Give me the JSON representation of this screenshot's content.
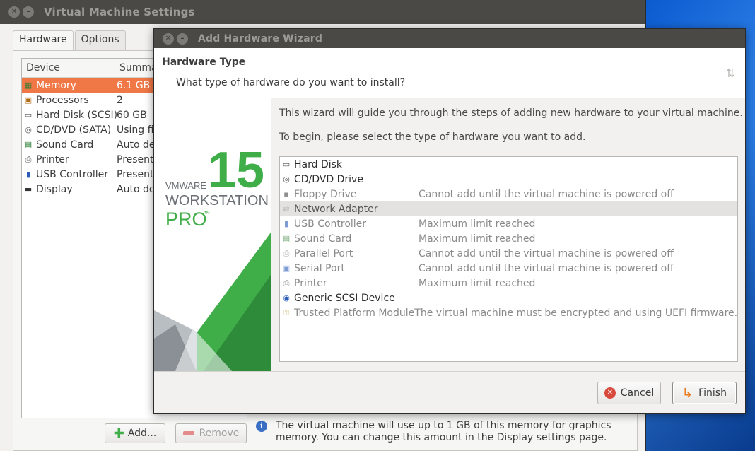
{
  "main_window": {
    "title": "Virtual Machine Settings",
    "tabs": [
      {
        "label": "Hardware",
        "active": true
      },
      {
        "label": "Options",
        "active": false
      }
    ],
    "device_table": {
      "columns": [
        "Device",
        "Summary"
      ],
      "column_visible": [
        "Device",
        "Summa"
      ],
      "rows": [
        {
          "icon": "memory-icon",
          "device": "Memory",
          "summary": "6.1 GB",
          "selected": true
        },
        {
          "icon": "cpu-icon",
          "device": "Processors",
          "summary": "2"
        },
        {
          "icon": "harddisk-icon",
          "device": "Hard Disk (SCSI)",
          "summary": "60 GB"
        },
        {
          "icon": "cd-icon",
          "device": "CD/DVD (SATA)",
          "summary": "Using fi"
        },
        {
          "icon": "soundcard-icon",
          "device": "Sound Card",
          "summary": "Auto de"
        },
        {
          "icon": "printer-icon",
          "device": "Printer",
          "summary": "Present"
        },
        {
          "icon": "usb-icon",
          "device": "USB Controller",
          "summary": "Present"
        },
        {
          "icon": "display-icon",
          "device": "Display",
          "summary": "Auto de"
        }
      ]
    },
    "add_button": "Add...",
    "remove_button": "Remove",
    "info_text_line1": "The virtual machine will use up to 1 GB of this memory for graphics",
    "info_text_line2": "memory. You can change this amount in the Display settings page."
  },
  "wizard": {
    "title": "Add Hardware Wizard",
    "header_title": "Hardware Type",
    "header_subtitle": "What type of hardware do you want to install?",
    "intro_line1": "This wizard will guide you through the steps of adding new hardware to your virtual machine.",
    "intro_line2": "To begin, please select the type of hardware you want to add.",
    "banner": {
      "brand": "VMWARE",
      "version": "15",
      "product": "WORKSTATION",
      "edition": "PRO",
      "tm": "™"
    },
    "hardware_list": [
      {
        "icon": "harddisk-icon",
        "name": "Hard Disk",
        "note": "",
        "state": "enabled"
      },
      {
        "icon": "cd-icon",
        "name": "CD/DVD Drive",
        "note": "",
        "state": "enabled"
      },
      {
        "icon": "floppy-icon",
        "name": "Floppy Drive",
        "note": "Cannot add until the virtual machine is powered off",
        "state": "disabled"
      },
      {
        "icon": "network-icon",
        "name": "Network Adapter",
        "note": "",
        "state": "selected"
      },
      {
        "icon": "usb-icon",
        "name": "USB Controller",
        "note": "Maximum limit reached",
        "state": "disabled"
      },
      {
        "icon": "soundcard-icon",
        "name": "Sound Card",
        "note": "Maximum limit reached",
        "state": "disabled"
      },
      {
        "icon": "parallel-port-icon",
        "name": "Parallel Port",
        "note": "Cannot add until the virtual machine is powered off",
        "state": "disabled"
      },
      {
        "icon": "serial-port-icon",
        "name": "Serial Port",
        "note": "Cannot add until the virtual machine is powered off",
        "state": "disabled"
      },
      {
        "icon": "printer-icon",
        "name": "Printer",
        "note": "Maximum limit reached",
        "state": "disabled"
      },
      {
        "icon": "scsi-icon",
        "name": "Generic SCSI Device",
        "note": "",
        "state": "enabled"
      },
      {
        "icon": "tpm-icon",
        "name": "Trusted Platform Module",
        "note": "The virtual machine must be encrypted and using UEFI firmware.",
        "state": "disabled"
      }
    ],
    "cancel_button": "Cancel",
    "finish_button": "Finish"
  },
  "colors": {
    "titlebar": "#3c3b37",
    "selection_orange": "#f07746",
    "vmware_green": "#3fae49",
    "vmware_dark_green": "#2e7d32",
    "desktop_blue": "#0b5bd1"
  }
}
